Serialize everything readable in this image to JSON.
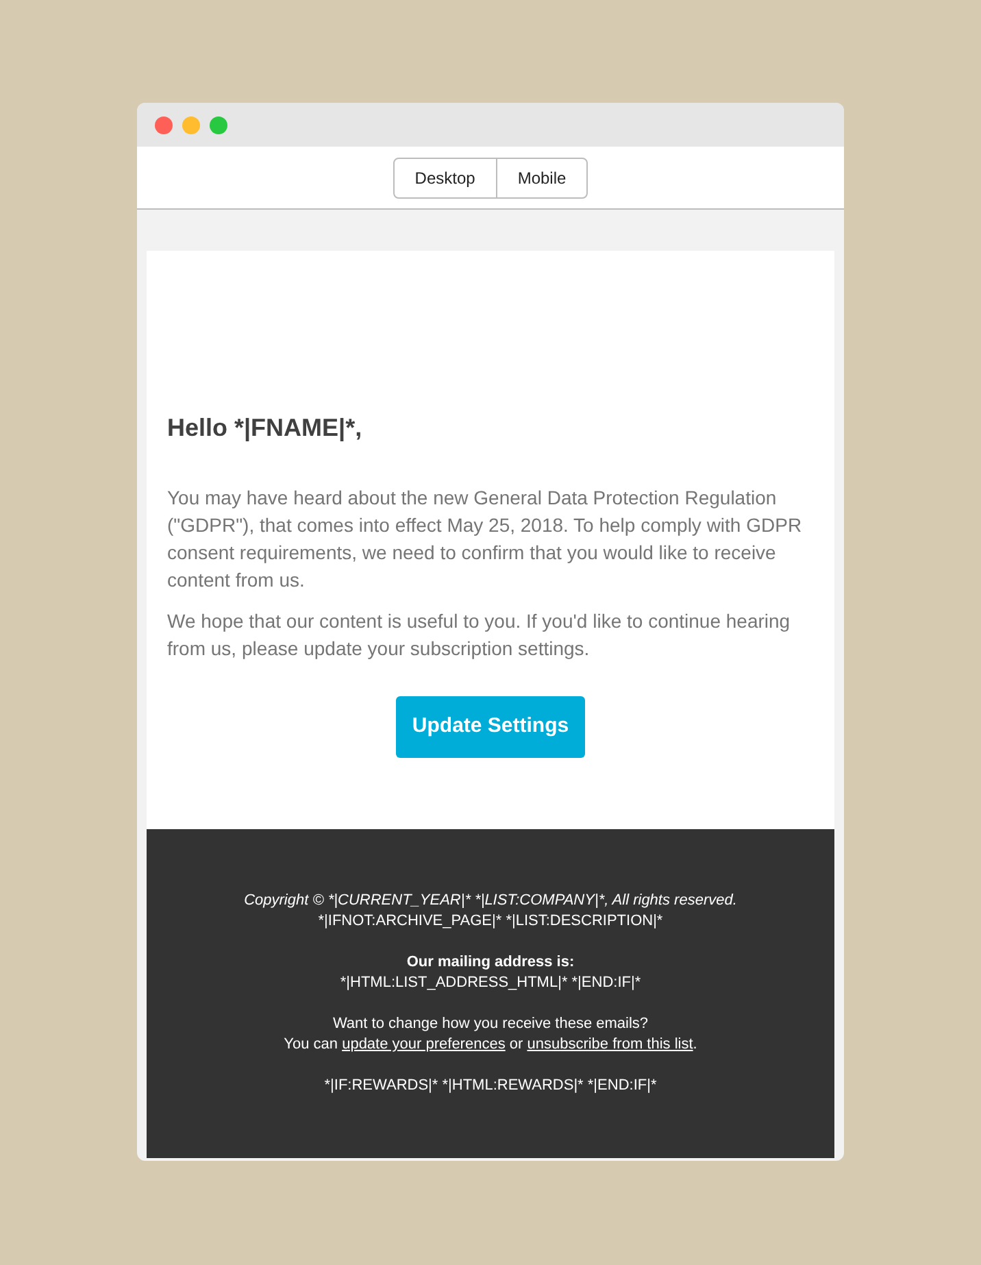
{
  "toolbar": {
    "buttons": [
      {
        "label": "Desktop"
      },
      {
        "label": "Mobile"
      }
    ]
  },
  "email": {
    "greeting": "Hello *|FNAME|*,",
    "paragraphs": [
      "You may have heard about the new General Data Protection Regulation (\"GDPR\"), that comes into effect May 25, 2018. To help comply with GDPR consent requirements, we need to confirm that you would like to receive content from us.",
      "We hope that our content is useful to you. If you'd like to continue hearing from us, please update your subscription settings."
    ],
    "button": "Update Settings"
  },
  "footer": {
    "copyright": "Copyright © *|CURRENT_YEAR|* *|LIST:COMPANY|*, All rights reserved.",
    "description_line": "*|IFNOT:ARCHIVE_PAGE|* *|LIST:DESCRIPTION|*",
    "address_heading": "Our mailing address is:",
    "address_line": "*|HTML:LIST_ADDRESS_HTML|* *|END:IF|*",
    "change_question": "Want to change how you receive these emails?",
    "change_line": {
      "before": "You can ",
      "link_1": "update your preferences",
      "middle": " or ",
      "link_2": "unsubscribe from this list",
      "after": "."
    },
    "rewards_line": "*|IF:REWARDS|* *|HTML:REWARDS|* *|END:IF|*"
  }
}
